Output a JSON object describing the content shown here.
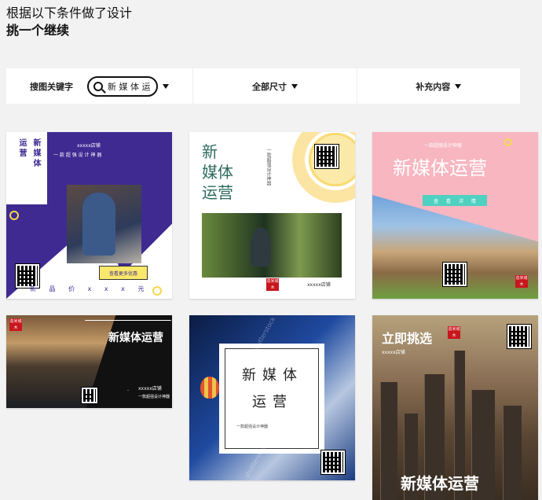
{
  "header": {
    "line1": "根据以下条件做了设计",
    "line2": "挑一个继续"
  },
  "filters": {
    "keyword_label": "搜图关键字",
    "keyword_value": "新 媒 体 运",
    "size_label": "全部尺寸",
    "content_label": "补充内容"
  },
  "cards": {
    "c1": {
      "vertical_left": "运营",
      "vertical_right": "新媒体",
      "top_small": "xxxxx店铺",
      "sub_small": "一 款 超 强 设 计 神 器",
      "badge": "查看更多优惠",
      "price": "新 品 价 x x x 元"
    },
    "c2": {
      "title_1": "新",
      "title_2": "媒体",
      "title_3": "运营",
      "vertical_small": "一款超强设计神器",
      "shop": "xxxxx店铺",
      "seal": "造米城木"
    },
    "c3": {
      "top_small": "一款超强设计神器",
      "title": "新媒体运营",
      "teal_label": "查 看 详 情",
      "seal": "造米城木"
    },
    "c4": {
      "title": "新媒体运营",
      "shop": "xxxxx店铺",
      "sub": "一款超强设计神器",
      "seal": "造米城木"
    },
    "c5": {
      "title": "新媒体运营",
      "sub": "一款超强设计神器",
      "watermark_1": "shutterstock",
      "watermark_2": "shutterstock"
    },
    "c6": {
      "title_top": "立即挑选",
      "sub": "xxxxx店铺",
      "title_bottom": "新媒体运营",
      "seal": "造米城木"
    }
  },
  "colors": {
    "purple": "#3f2a92",
    "teal_title": "#2d6b5c",
    "pink": "#f7b6c0",
    "seal_red": "#c8161d"
  }
}
